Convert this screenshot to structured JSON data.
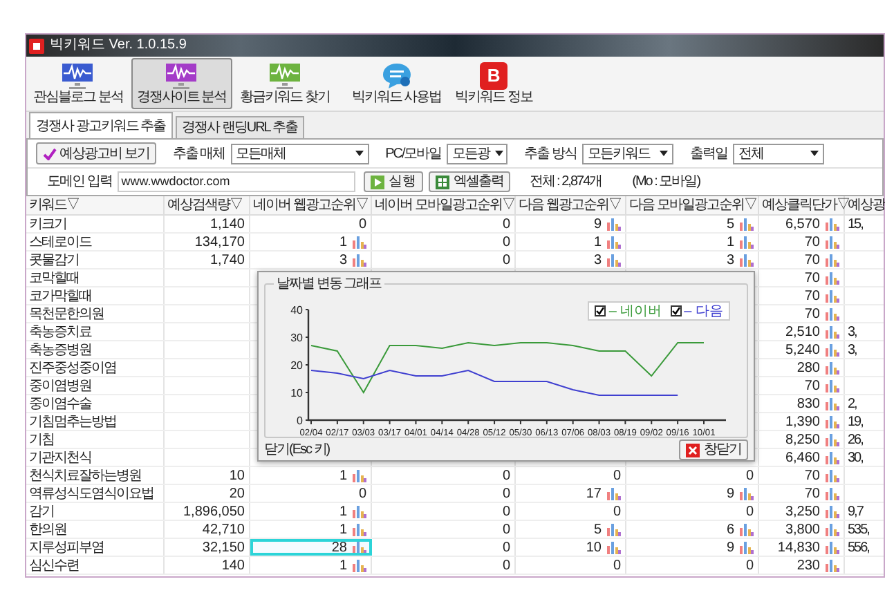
{
  "window": {
    "title": "빅키워드 Ver. 1.0.15.9"
  },
  "toolbar": [
    {
      "label": "관심블로그 분석",
      "kind": "wave",
      "color": "#3a5bd0",
      "selected": false
    },
    {
      "label": "경쟁사이트 분석",
      "kind": "wave",
      "color": "#a43cc8",
      "selected": true
    },
    {
      "label": "황금키워드 찾기",
      "kind": "wave",
      "color": "#6db33f",
      "selected": false
    },
    {
      "label": "빅키워드 사용법",
      "kind": "chat",
      "selected": false
    },
    {
      "label": "빅키워드 정보",
      "kind": "badge",
      "badge": "B",
      "selected": false
    }
  ],
  "tabs": [
    {
      "label": "경쟁사 광고키워드 추출",
      "selected": true
    },
    {
      "label": "경쟁사 랜딩URL 추출",
      "selected": false
    }
  ],
  "options": {
    "cost_button": "예상광고비 보기",
    "filters": [
      {
        "label": "추출 매체",
        "value": "모든매체"
      },
      {
        "label": "PC/모바일",
        "value": "모든광"
      },
      {
        "label": "추출 방식",
        "value": "모든키워드"
      },
      {
        "label": "출력일",
        "value": "전체"
      }
    ]
  },
  "domain": {
    "label": "도메인 입력",
    "value": "www.wwdoctor.com",
    "run_button": "실행",
    "excel_button": "엑셀출력",
    "total": "전체 : 2,874개",
    "note": "(Mo : 모바일)"
  },
  "table": {
    "columns": [
      "키워드▽",
      "예상검색량▽",
      "네이버 웹광고순위▽",
      "네이버 모바일광고순위▽",
      "다음 웹광고순위▽",
      "다음 모바일광고순위▽",
      "예상클릭단가▽",
      "예상광"
    ],
    "rows": [
      {
        "cells": [
          {
            "text": "키크기",
            "selected": false
          },
          {
            "text": "1,140",
            "chart": false,
            "selected": false
          },
          {
            "text": "0",
            "chart": false,
            "selected": false
          },
          {
            "text": "0",
            "chart": false,
            "selected": false
          },
          {
            "text": "9",
            "chart": true,
            "selected": false
          },
          {
            "text": "5",
            "chart": true,
            "selected": false
          },
          {
            "text": "6,570",
            "chart": true,
            "selected": false
          },
          {
            "text": "15,",
            "selected": false
          }
        ]
      },
      {
        "cells": [
          {
            "text": "스테로이드",
            "selected": false
          },
          {
            "text": "134,170",
            "chart": false,
            "selected": false
          },
          {
            "text": "1",
            "chart": true,
            "selected": false
          },
          {
            "text": "0",
            "chart": false,
            "selected": false
          },
          {
            "text": "1",
            "chart": true,
            "selected": false
          },
          {
            "text": "1",
            "chart": true,
            "selected": false
          },
          {
            "text": "70",
            "chart": true,
            "selected": false
          },
          null
        ]
      },
      {
        "cells": [
          {
            "text": "콧물감기",
            "selected": false
          },
          {
            "text": "1,740",
            "chart": false,
            "selected": false
          },
          {
            "text": "3",
            "chart": true,
            "selected": false
          },
          {
            "text": "0",
            "chart": false,
            "selected": false
          },
          {
            "text": "3",
            "chart": true,
            "selected": false
          },
          {
            "text": "3",
            "chart": true,
            "selected": false
          },
          {
            "text": "70",
            "chart": true,
            "selected": false
          },
          null
        ]
      },
      {
        "cells": [
          {
            "text": "코막힐때",
            "selected": false
          },
          null,
          null,
          null,
          null,
          null,
          {
            "text": "70",
            "chart": true,
            "selected": false
          },
          null
        ]
      },
      {
        "cells": [
          {
            "text": "코가막힐때",
            "selected": false
          },
          null,
          null,
          null,
          null,
          null,
          {
            "text": "70",
            "chart": true,
            "selected": false
          },
          null
        ]
      },
      {
        "cells": [
          {
            "text": "목천문한의원",
            "selected": false
          },
          null,
          null,
          null,
          null,
          null,
          {
            "text": "70",
            "chart": true,
            "selected": false
          },
          null
        ]
      },
      {
        "cells": [
          {
            "text": "축농증치료",
            "selected": false
          },
          null,
          null,
          null,
          null,
          null,
          {
            "text": "2,510",
            "chart": true,
            "selected": false
          },
          {
            "text": "3,",
            "selected": false
          }
        ]
      },
      {
        "cells": [
          {
            "text": "축농증병원",
            "selected": false
          },
          null,
          null,
          null,
          null,
          null,
          {
            "text": "5,240",
            "chart": true,
            "selected": false
          },
          {
            "text": "3,",
            "selected": false
          }
        ]
      },
      {
        "cells": [
          {
            "text": "진주중성중이염",
            "selected": false
          },
          null,
          null,
          null,
          null,
          null,
          {
            "text": "280",
            "chart": true,
            "selected": false
          },
          null
        ]
      },
      {
        "cells": [
          {
            "text": "중이염병원",
            "selected": false
          },
          null,
          null,
          null,
          null,
          null,
          {
            "text": "70",
            "chart": true,
            "selected": false
          },
          null
        ]
      },
      {
        "cells": [
          {
            "text": "중이염수술",
            "selected": false
          },
          null,
          null,
          null,
          null,
          null,
          {
            "text": "830",
            "chart": true,
            "selected": false
          },
          {
            "text": "2,",
            "selected": false
          }
        ]
      },
      {
        "cells": [
          {
            "text": "기침멈추는방법",
            "selected": false
          },
          null,
          null,
          null,
          null,
          null,
          {
            "text": "1,390",
            "chart": true,
            "selected": false
          },
          {
            "text": "19,",
            "selected": false
          }
        ]
      },
      {
        "cells": [
          {
            "text": "기침",
            "selected": false
          },
          null,
          null,
          null,
          null,
          null,
          {
            "text": "8,250",
            "chart": true,
            "selected": false
          },
          {
            "text": "26,",
            "selected": false
          }
        ]
      },
      {
        "cells": [
          {
            "text": "기관지천식",
            "selected": false
          },
          null,
          null,
          null,
          null,
          null,
          {
            "text": "6,460",
            "chart": true,
            "selected": false
          },
          {
            "text": "30,",
            "selected": false
          }
        ]
      },
      {
        "cells": [
          {
            "text": "천식치료잘하는병원",
            "selected": false
          },
          {
            "text": "10",
            "chart": false,
            "selected": false
          },
          {
            "text": "1",
            "chart": true,
            "selected": false
          },
          {
            "text": "0",
            "chart": false,
            "selected": false
          },
          {
            "text": "0",
            "chart": false,
            "selected": false
          },
          {
            "text": "0",
            "chart": false,
            "selected": false
          },
          {
            "text": "70",
            "chart": true,
            "selected": false
          },
          null
        ]
      },
      {
        "cells": [
          {
            "text": "역류성식도염식이요법",
            "selected": false
          },
          {
            "text": "20",
            "chart": false,
            "selected": false
          },
          {
            "text": "0",
            "chart": false,
            "selected": false
          },
          {
            "text": "0",
            "chart": false,
            "selected": false
          },
          {
            "text": "17",
            "chart": true,
            "selected": false
          },
          {
            "text": "9",
            "chart": true,
            "selected": false
          },
          {
            "text": "70",
            "chart": true,
            "selected": false
          },
          null
        ]
      },
      {
        "cells": [
          {
            "text": "감기",
            "selected": false
          },
          {
            "text": "1,896,050",
            "chart": false,
            "selected": false
          },
          {
            "text": "1",
            "chart": true,
            "selected": false
          },
          {
            "text": "0",
            "chart": false,
            "selected": false
          },
          {
            "text": "0",
            "chart": false,
            "selected": false
          },
          {
            "text": "0",
            "chart": false,
            "selected": false
          },
          {
            "text": "3,250",
            "chart": true,
            "selected": false
          },
          {
            "text": "9,7",
            "selected": false
          }
        ]
      },
      {
        "cells": [
          {
            "text": "한의원",
            "selected": false
          },
          {
            "text": "42,710",
            "chart": false,
            "selected": false
          },
          {
            "text": "1",
            "chart": true,
            "selected": false
          },
          {
            "text": "0",
            "chart": false,
            "selected": false
          },
          {
            "text": "5",
            "chart": true,
            "selected": false
          },
          {
            "text": "6",
            "chart": true,
            "selected": false
          },
          {
            "text": "3,800",
            "chart": true,
            "selected": false
          },
          {
            "text": "535,",
            "selected": false
          }
        ]
      },
      {
        "cells": [
          {
            "text": "지루성피부염",
            "selected": false
          },
          {
            "text": "32,150",
            "chart": false,
            "selected": false
          },
          {
            "text": "28",
            "chart": true,
            "selected": true
          },
          {
            "text": "0",
            "chart": false,
            "selected": false
          },
          {
            "text": "10",
            "chart": true,
            "selected": false
          },
          {
            "text": "9",
            "chart": true,
            "selected": false
          },
          {
            "text": "14,830",
            "chart": true,
            "selected": false
          },
          {
            "text": "556,",
            "selected": false
          }
        ]
      },
      {
        "cells": [
          {
            "text": "심신수련",
            "selected": false
          },
          {
            "text": "140",
            "chart": false,
            "selected": false
          },
          {
            "text": "1",
            "chart": true,
            "selected": false
          },
          {
            "text": "0",
            "chart": false,
            "selected": false
          },
          {
            "text": "0",
            "chart": false,
            "selected": false
          },
          {
            "text": "0",
            "chart": false,
            "selected": false
          },
          {
            "text": "230",
            "chart": true,
            "selected": false
          },
          null
        ]
      }
    ]
  },
  "dialog": {
    "title": "날짜별 변동 그래프",
    "legend": [
      {
        "dash": "–",
        "checked": true
      },
      {
        "dash": "–",
        "checked": true
      }
    ],
    "chart_data": {
      "type": "line",
      "ylim": [
        0,
        40
      ],
      "yticks": [
        0,
        10,
        20,
        30,
        40
      ],
      "categories": [
        "02/04",
        "02/17",
        "03/03",
        "03/17",
        "04/01",
        "04/14",
        "04/28",
        "05/12",
        "05/30",
        "06/13",
        "07/06",
        "08/03",
        "08/19",
        "09/02",
        "09/16",
        "10/01"
      ],
      "series": [
        {
          "name": "네이버",
          "color": "#3a9a3a",
          "values": [
            27,
            25,
            10,
            27,
            27,
            26,
            28,
            27,
            28,
            28,
            27,
            25,
            25,
            16,
            28,
            28
          ]
        },
        {
          "name": "다음",
          "color": "#4040d0",
          "values": [
            18,
            17,
            15,
            18,
            16,
            16,
            18,
            14,
            14,
            14,
            11,
            9,
            9,
            9,
            9,
            null
          ]
        }
      ]
    },
    "close_hint": "닫기(Esc 키)",
    "close_button": "창닫기"
  }
}
